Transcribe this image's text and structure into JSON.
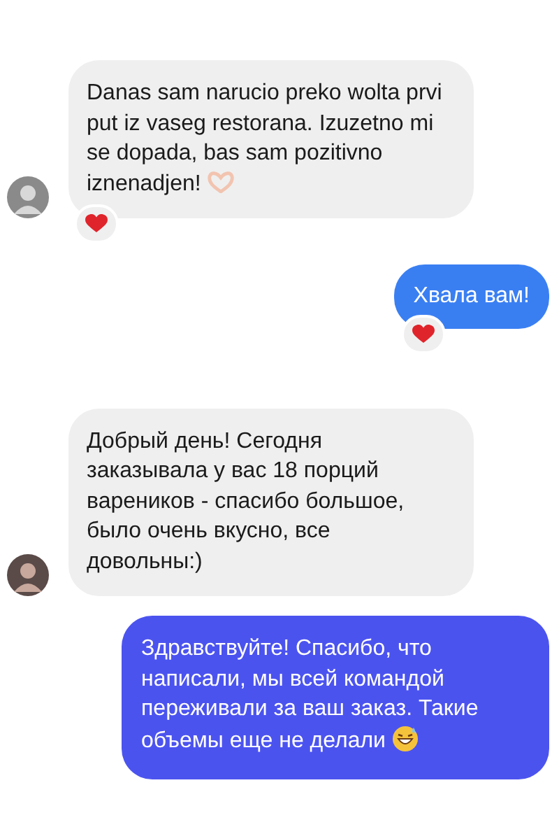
{
  "messages": [
    {
      "kind": "incoming",
      "text": "Danas sam narucio preko wolta prvi put iz vaseg restorana. Izuzetno mi se dopada, bas sam pozitivno iznenadjen!",
      "emoji": {
        "kind": "heart-hands"
      },
      "reacted": true
    },
    {
      "kind": "outgoing",
      "color": "#3a7ff2",
      "text": "Хвала вам!",
      "reacted": true
    },
    {
      "kind": "incoming",
      "text": "Добрый день! Сегодня заказывала у вас 18 порций вареников - спасибо большое, было очень вкусно, все довольны:)",
      "reacted": false
    },
    {
      "kind": "outgoing",
      "color": "#4b53ef",
      "text": "Здравствуйте! Спасибо, что написали, мы всей командой переживали за ваш заказ. Такие объемы еще не делали",
      "emoji": {
        "kind": "sweat-smile"
      },
      "reacted": false
    }
  ]
}
